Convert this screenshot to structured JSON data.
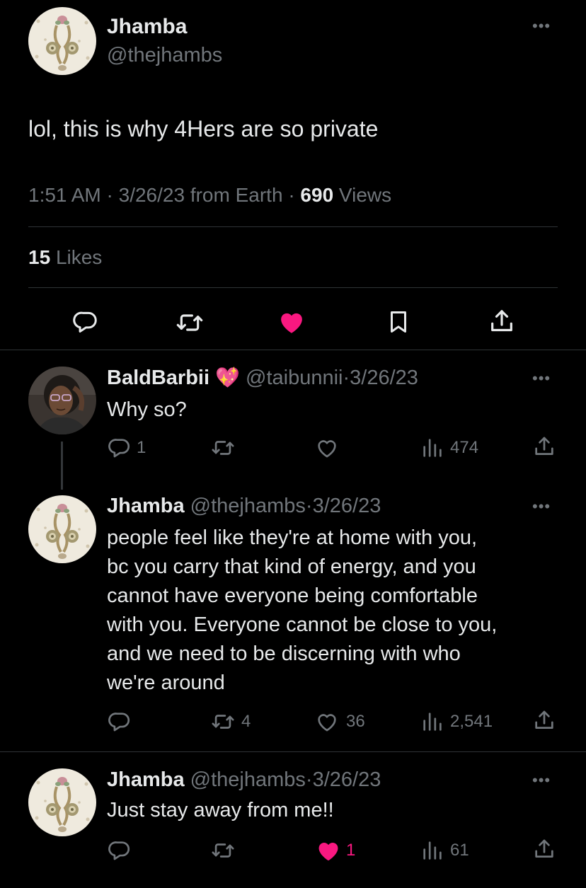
{
  "main_tweet": {
    "display_name": "Jhamba",
    "handle": "@thejhambs",
    "text": "lol, this is why 4Hers are so private",
    "time": "1:51 AM",
    "date": "3/26/23",
    "source": "from Earth",
    "views_count": "690",
    "views_label": "Views",
    "likes_count": "15",
    "likes_label": "Likes",
    "liked": true
  },
  "replies": [
    {
      "display_name": "BaldBarbii",
      "emoji": "💖",
      "handle": "@taibunnii",
      "date": "3/26/23",
      "text": "Why so?",
      "reply_count": "1",
      "retweet_count": "",
      "like_count": "",
      "view_count": "474"
    },
    {
      "display_name": "Jhamba",
      "handle": "@thejhambs",
      "date": "3/26/23",
      "text_lines": [
        "people feel like they're at home with you,",
        "bc you carry that kind of energy, and you",
        "cannot have everyone being comfortable",
        "with you. Everyone cannot be close to you,",
        "and we need to be discerning with who",
        "we're around"
      ],
      "reply_count": "",
      "retweet_count": "4",
      "like_count": "36",
      "view_count": "2,541"
    },
    {
      "display_name": "Jhamba",
      "handle": "@thejhambs",
      "date": "3/26/23",
      "text": "Just stay away from me!!",
      "reply_count": "",
      "retweet_count": "",
      "like_count": "1",
      "view_count": "61",
      "liked": true
    }
  ],
  "colors": {
    "background": "#000000",
    "text": "#e7e9ea",
    "muted": "#71767b",
    "like": "#f91880",
    "divider": "#2f3336"
  },
  "icons": {
    "reply": "reply-icon",
    "retweet": "retweet-icon",
    "like": "heart-icon",
    "bookmark": "bookmark-icon",
    "share": "share-icon",
    "views": "views-icon",
    "more": "more-icon"
  }
}
